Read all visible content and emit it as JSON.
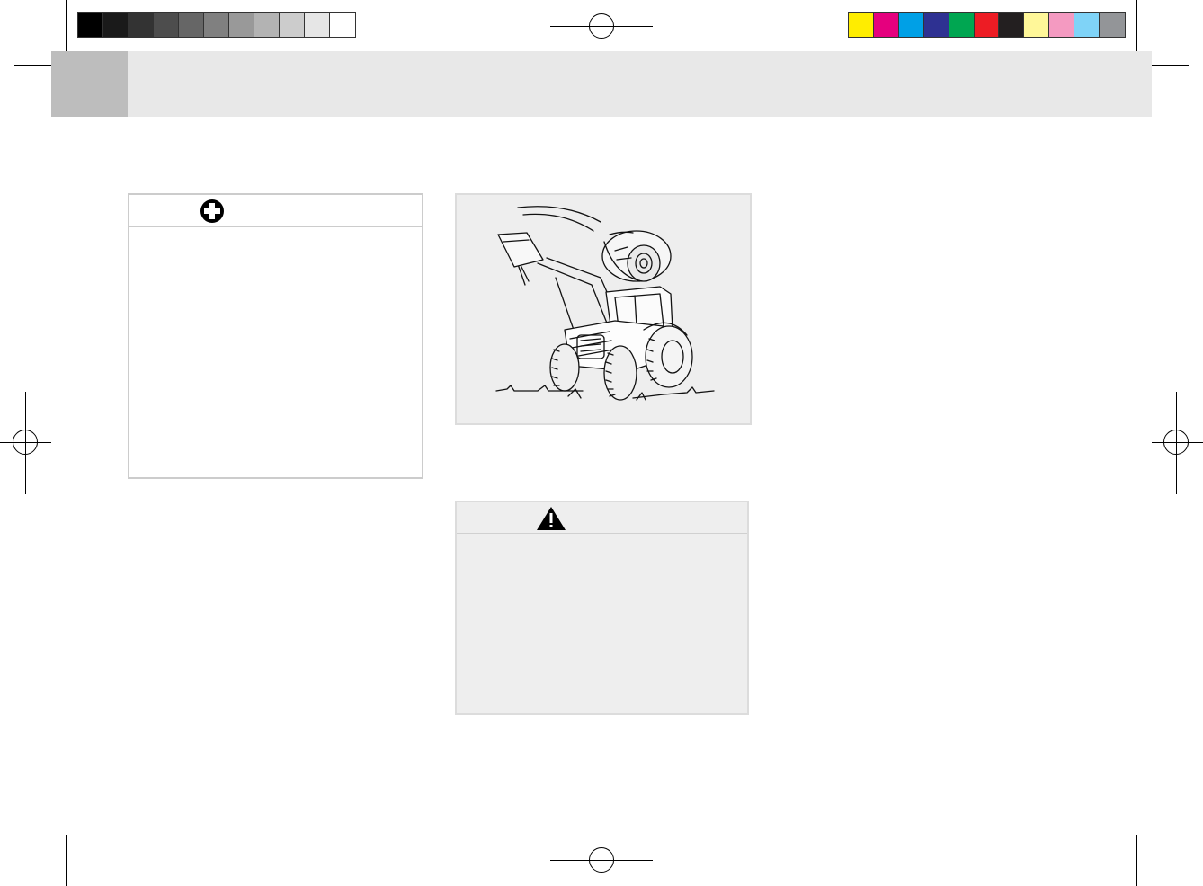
{
  "print_marks": {
    "gray_swatches": [
      "#000000",
      "#1a1a1a",
      "#333333",
      "#4d4d4d",
      "#666666",
      "#808080",
      "#999999",
      "#b3b3b3",
      "#cccccc",
      "#e6e6e6",
      "#ffffff"
    ],
    "color_swatches": [
      "#ffed00",
      "#e5007e",
      "#00a0e6",
      "#2e3192",
      "#00a651",
      "#ed1c24",
      "#231f20",
      "#fff799",
      "#f49ac1",
      "#7fd3f7",
      "#939598"
    ]
  },
  "header": {
    "band_color": "#e8e8e8",
    "tab_color": "#bdbdbd"
  },
  "info_box": {
    "icon": "plus-circle-icon"
  },
  "figure": {
    "subject": "tractor-front-loader-lifting-round-bale-illustration"
  },
  "warning_box": {
    "icon": "warning-triangle-icon"
  }
}
